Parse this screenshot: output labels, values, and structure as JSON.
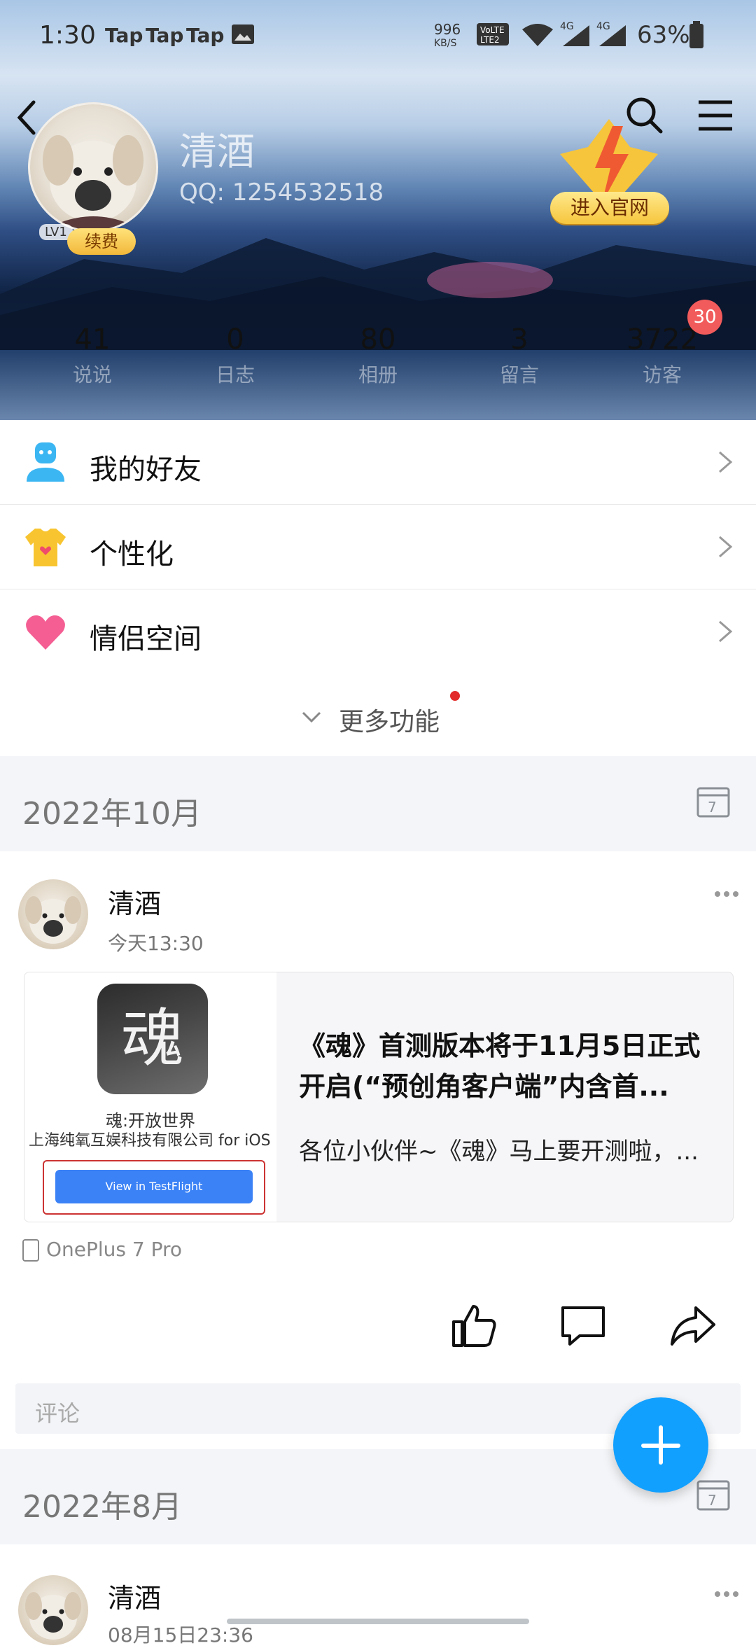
{
  "status_bar": {
    "time": "1:30",
    "taps": [
      "Tap",
      "Tap",
      "Tap"
    ],
    "speed": "996",
    "speed_unit": "KB/S",
    "battery": "63%"
  },
  "profile": {
    "name": "清酒",
    "qq": "QQ: 1254532518",
    "level": "LV1",
    "renew": "续费",
    "enter_site": "进入官网"
  },
  "stats": [
    {
      "value": "41",
      "label": "说说"
    },
    {
      "value": "0",
      "label": "日志"
    },
    {
      "value": "80",
      "label": "相册"
    },
    {
      "value": "3",
      "label": "留言"
    },
    {
      "value": "3722",
      "label": "访客"
    }
  ],
  "visitor_badge": "30",
  "menu": [
    {
      "label": "我的好友",
      "icon": "friend-icon"
    },
    {
      "label": "个性化",
      "icon": "tshirt-icon"
    },
    {
      "label": "情侣空间",
      "icon": "heart-icon"
    }
  ],
  "more_functions": "更多功能",
  "sections": [
    {
      "date": "2022年10月"
    },
    {
      "date": "2022年8月"
    }
  ],
  "posts": [
    {
      "user": "清酒",
      "time": "今天13:30",
      "card": {
        "app_logo_char": "魂",
        "game_name": "魂:开放世界",
        "company": "上海纯氧互娱科技有限公司 for iOS",
        "testflight_btn": "View in TestFlight",
        "title": "《魂》首测版本将于11月5日正式开启(“预创角客户端”内含首...",
        "desc": "各位小伙伴~《魂》马上要开测啦，..."
      },
      "device": "OnePlus 7 Pro",
      "comment_placeholder": "评论"
    },
    {
      "user": "清酒",
      "time": "08月15日23:36"
    }
  ]
}
